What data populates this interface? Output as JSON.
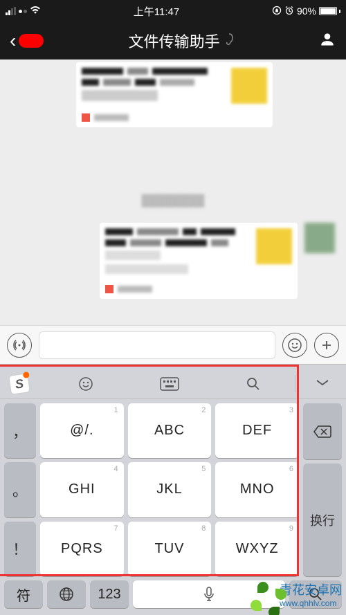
{
  "status": {
    "time": "上午11:47",
    "battery_pct": "90%"
  },
  "nav": {
    "unread_placeholder": " ",
    "title": "文件传输助手"
  },
  "input": {
    "placeholder": ""
  },
  "keyboard": {
    "left_keys": [
      "，",
      "。",
      "！"
    ],
    "grid": [
      [
        {
          "n": "1",
          "l": "@/."
        },
        {
          "n": "2",
          "l": "ABC"
        },
        {
          "n": "3",
          "l": "DEF"
        }
      ],
      [
        {
          "n": "4",
          "l": "GHI"
        },
        {
          "n": "5",
          "l": "JKL"
        },
        {
          "n": "6",
          "l": "MNO"
        }
      ],
      [
        {
          "n": "7",
          "l": "PQRS"
        },
        {
          "n": "8",
          "l": "TUV"
        },
        {
          "n": "9",
          "l": "WXYZ"
        }
      ]
    ],
    "right_top": "⌫",
    "right_bottom": "换行",
    "bottom": {
      "sym": "符",
      "num": "123"
    }
  },
  "watermark": {
    "brand": "青花安卓网",
    "url": "www.qhhlv.com"
  }
}
